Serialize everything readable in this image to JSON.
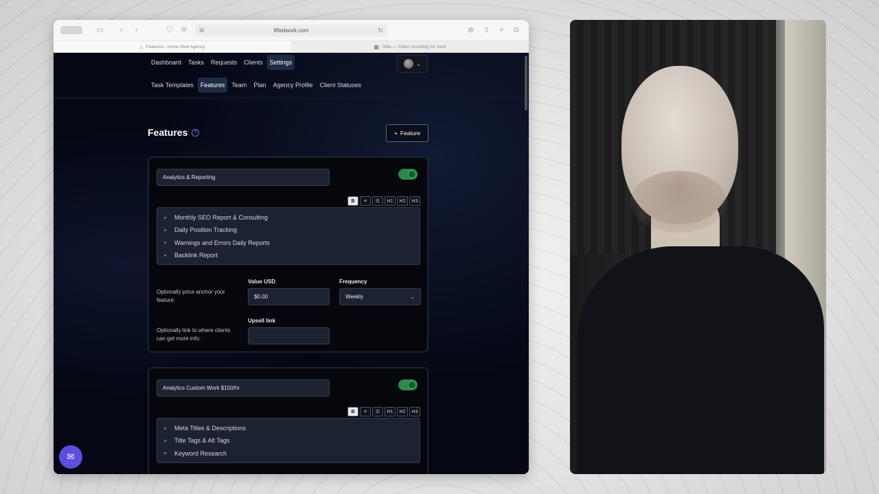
{
  "browser": {
    "url": "liftedwork.com",
    "tabs": [
      {
        "label": "Features - Acme Web Agency",
        "active": true
      },
      {
        "label": "Tella — Video recording for work",
        "active": false
      }
    ]
  },
  "nav": {
    "items": [
      "Dashboard",
      "Tasks",
      "Requests",
      "Clients",
      "Settings"
    ],
    "active": "Settings"
  },
  "subnav": {
    "items": [
      "Task Templates",
      "Features",
      "Team",
      "Plan",
      "Agency Profile",
      "Client Statuses"
    ],
    "active": "Features"
  },
  "page": {
    "title": "Features",
    "help_glyph": "?",
    "add_button_label": "Feature",
    "add_button_glyph": "+"
  },
  "editor_toolbar": [
    "B",
    "≡",
    "☰",
    "H1",
    "H2",
    "H3"
  ],
  "cards": [
    {
      "name": "Analytics & Reporting",
      "enabled": true,
      "features": [
        "Monthly SEO Report & Consulting",
        "Daily Position Tracking",
        "Warnings and Errors Daily Reports",
        "Backlink Report"
      ],
      "price_hint": "Optionally price anchor your feature:",
      "value_label": "Value USD",
      "value": "$0.00",
      "frequency_label": "Frequency",
      "frequency": "Weekly",
      "link_hint": "Optionally link to where clients can get more info:",
      "link_label": "Upsell link",
      "link_value": ""
    },
    {
      "name": "Analytics Custom Work $150/hr",
      "enabled": true,
      "features": [
        "Meta Titles & Descriptions",
        "Title Tags & Alt Tags",
        "Keyword Research"
      ]
    }
  ],
  "colors": {
    "accent": "#5b4ee0",
    "toggle_on": "#2a8a4a",
    "app_bg": "#050814"
  }
}
